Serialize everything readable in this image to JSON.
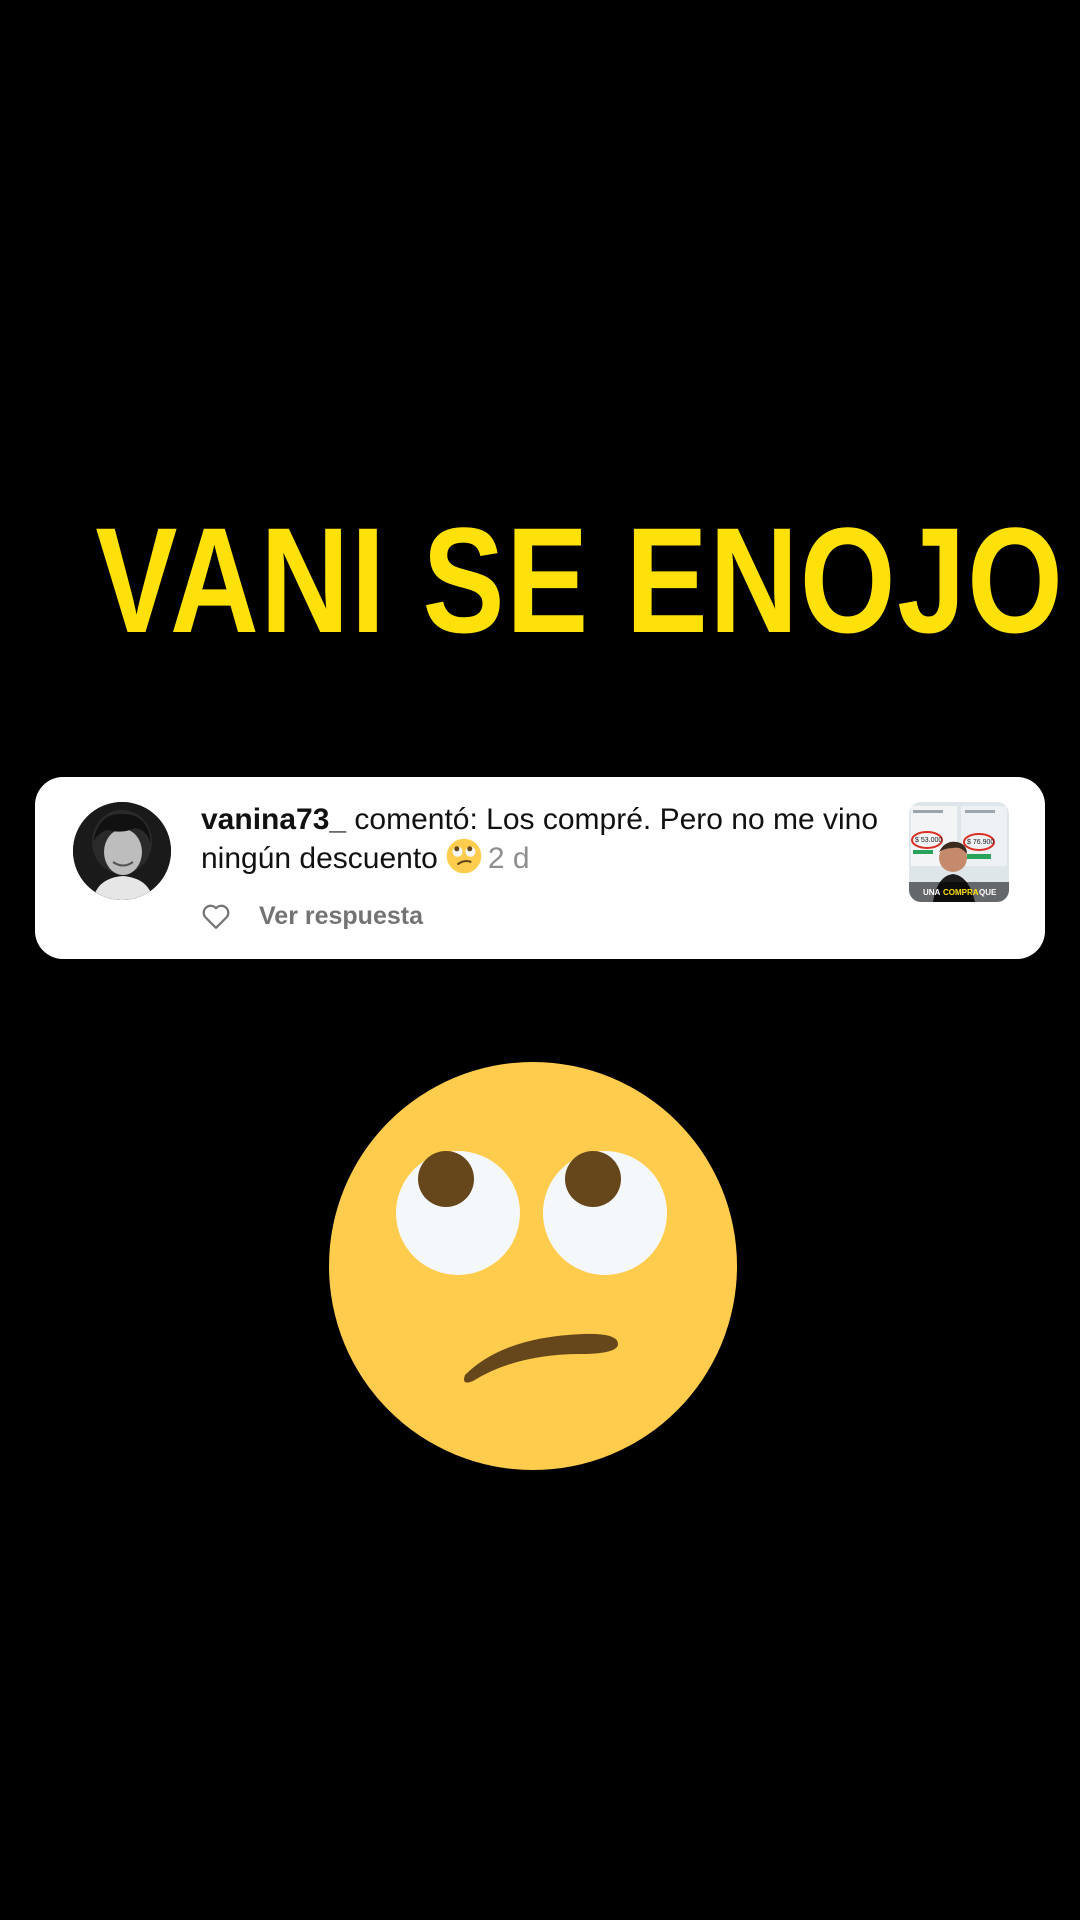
{
  "headline": {
    "text": "VANI SE ENOJO",
    "color": "#FFE10A"
  },
  "notification": {
    "username": "vanina73_",
    "message": " comentó: Los compré. Pero no me vino ningún descuento",
    "age": "2 d",
    "reply_label": "Ver respuesta",
    "like_icon": "heart-outline-icon",
    "emoji_icon": "face-with-rolling-eyes-icon"
  },
  "thumbnail": {
    "price_left": "$ 53.000",
    "price_right": "$ 76.900",
    "caption_word1": "UNA",
    "caption_word2": "COMPRA",
    "caption_word3": "QUE"
  },
  "reaction_emoji": {
    "icon": "face-with-rolling-eyes-icon",
    "color": "#FFCC4D"
  }
}
